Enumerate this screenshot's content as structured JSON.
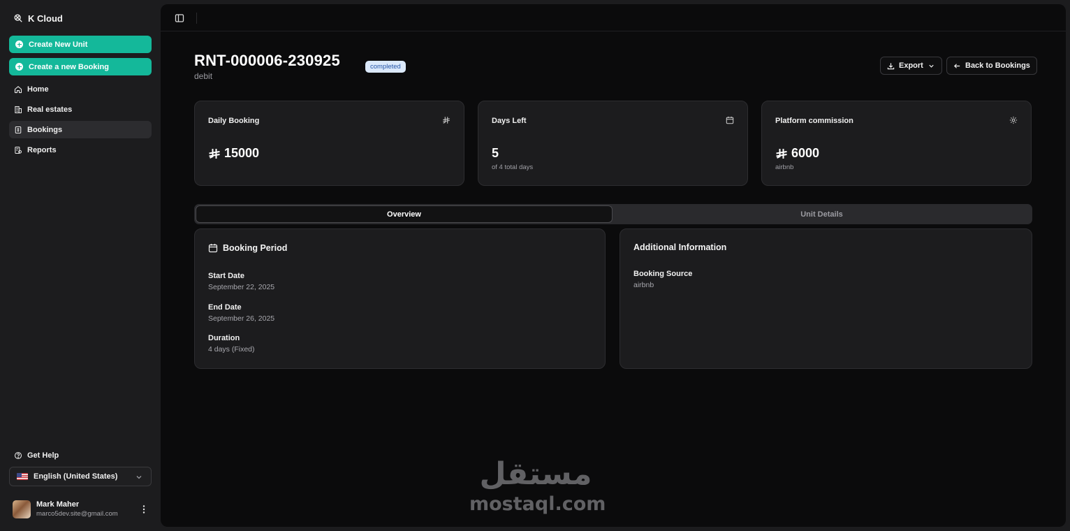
{
  "app": {
    "name": "K Cloud"
  },
  "sidebar": {
    "actions": [
      {
        "label": "Create New Unit"
      },
      {
        "label": "Create a new Booking"
      }
    ],
    "nav": [
      {
        "label": "Home",
        "icon": "home-icon"
      },
      {
        "label": "Real estates",
        "icon": "building-icon"
      },
      {
        "label": "Bookings",
        "icon": "bookings-icon",
        "active": true
      },
      {
        "label": "Reports",
        "icon": "reports-icon"
      }
    ],
    "help_label": "Get Help",
    "language": "English (United States)",
    "user": {
      "name": "Mark Maher",
      "email": "marco5dev.site@gmail.com"
    }
  },
  "page": {
    "title": "RNT-000006-230925",
    "status": "completed",
    "subtitle": "debit",
    "export_label": "Export",
    "back_label": "Back to Bookings"
  },
  "stats": [
    {
      "label": "Daily Booking",
      "value": "15000",
      "sub": "",
      "icon": "riyal-icon"
    },
    {
      "label": "Days Left",
      "value": "5",
      "sub": "of 4 total days",
      "icon": "calendar-icon"
    },
    {
      "label": "Platform commission",
      "value": "6000",
      "sub": "airbnb",
      "icon": "gear-icon"
    }
  ],
  "tabs": [
    {
      "label": "Overview",
      "active": true
    },
    {
      "label": "Unit Details",
      "active": false
    }
  ],
  "booking_period": {
    "title": "Booking Period",
    "fields": [
      {
        "label": "Start Date",
        "value": "September 22, 2025"
      },
      {
        "label": "End Date",
        "value": "September 26, 2025"
      },
      {
        "label": "Duration",
        "value": "4 days (Fixed)"
      }
    ]
  },
  "additional_info": {
    "title": "Additional Information",
    "fields": [
      {
        "label": "Booking Source",
        "value": "airbnb"
      }
    ]
  },
  "watermark": {
    "arabic": "مستقل",
    "latin": "mostaql.com"
  },
  "colors": {
    "accent": "#14b89a",
    "badge_bg": "#dbe9fb",
    "badge_text": "#2556a8"
  }
}
